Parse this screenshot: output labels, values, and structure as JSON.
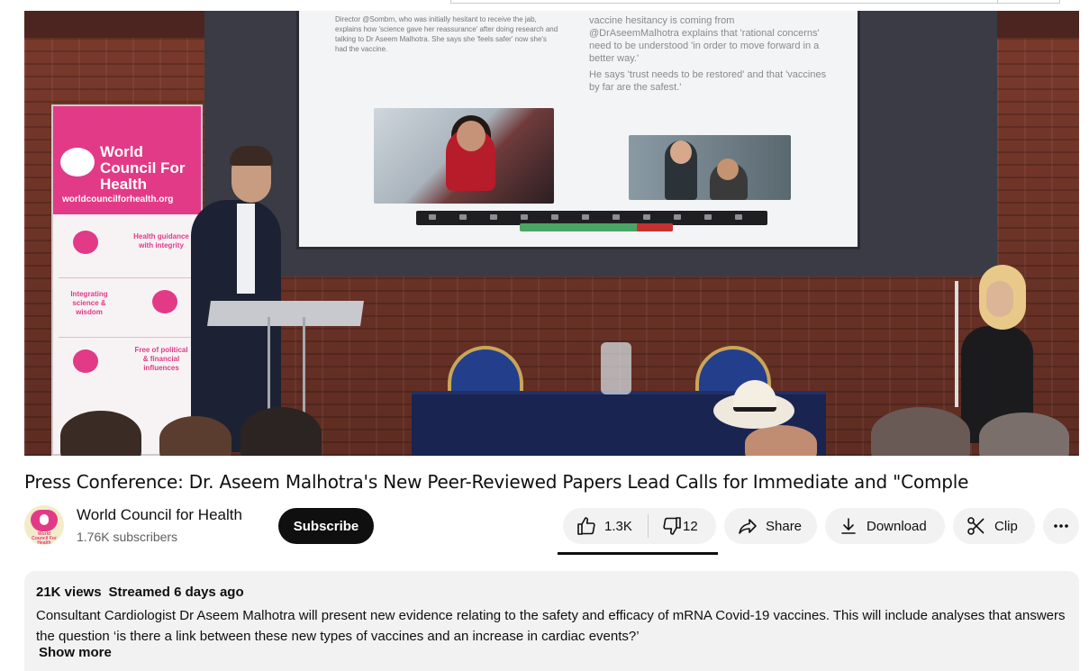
{
  "video": {
    "banner": {
      "org_name": "World Council For Health",
      "url": "worldcouncilforhealth.org",
      "cells": [
        "Health guidance with integrity",
        "Integrating science & wisdom",
        "Free of political & financial influences"
      ]
    },
    "slide": {
      "left_text": "Director @Sombrn, who was initially hesitant to receive the jab, explains how 'science gave her reassurance' after doing research and talking to Dr Aseem Malhotra. She says she 'feels safer' now she's had the vaccine.",
      "right_text_1": "vaccine hesitancy is coming from",
      "right_text_2": "@DrAseemMalhotra explains that 'rational concerns' need to be understood 'in order to move forward in a better way.'",
      "right_text_3": "He says 'trust needs to be restored' and that 'vaccines by far are the safest.'"
    }
  },
  "title": "Press Conference: Dr. Aseem Malhotra's New Peer-Reviewed Papers Lead Calls for Immediate and \"Comple",
  "channel": {
    "name": "World Council for Health",
    "subscribers": "1.76K subscribers",
    "avatar_text": "World Council For Health"
  },
  "actions": {
    "subscribe": "Subscribe",
    "like_count": "1.3K",
    "dislike_count": "12",
    "share": "Share",
    "download": "Download",
    "clip": "Clip",
    "more_icon": "more-horizontal-icon"
  },
  "description": {
    "views": "21K views",
    "streamed": "Streamed 6 days ago",
    "text": "Consultant Cardiologist Dr Aseem Malhotra will present new evidence relating to the safety and efficacy of mRNA Covid-19 vaccines. This will include analyses that answers the question ‘is there a link between these new types of vaccines and an increase in cardiac events?’",
    "show_more": "Show more"
  },
  "colors": {
    "brand_pink": "#e23a86",
    "subscribe_bg": "#0f0f0f",
    "pill_bg": "#f2f2f2"
  }
}
